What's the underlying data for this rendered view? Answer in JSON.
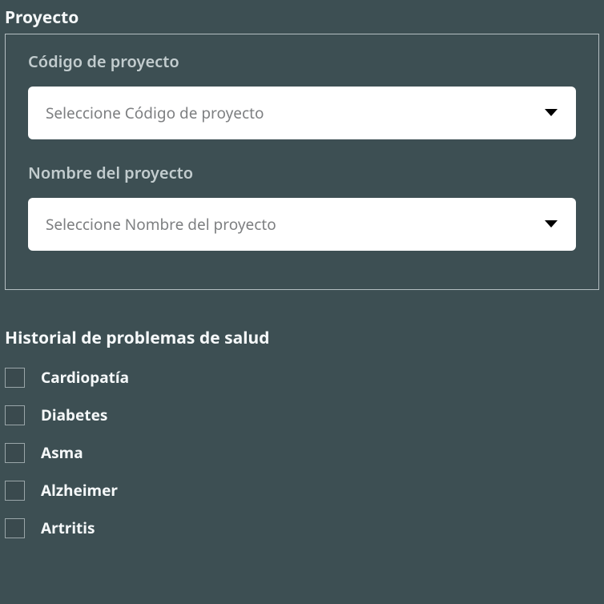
{
  "proyecto": {
    "title": "Proyecto",
    "codigo": {
      "label": "Código de proyecto",
      "placeholder": "Seleccione Código de proyecto"
    },
    "nombre": {
      "label": "Nombre del proyecto",
      "placeholder": "Seleccione Nombre del proyecto"
    }
  },
  "health": {
    "title": "Historial de problemas de salud",
    "items": [
      {
        "label": "Cardiopatía"
      },
      {
        "label": "Diabetes"
      },
      {
        "label": "Asma"
      },
      {
        "label": "Alzheimer"
      },
      {
        "label": "Artritis"
      }
    ]
  }
}
